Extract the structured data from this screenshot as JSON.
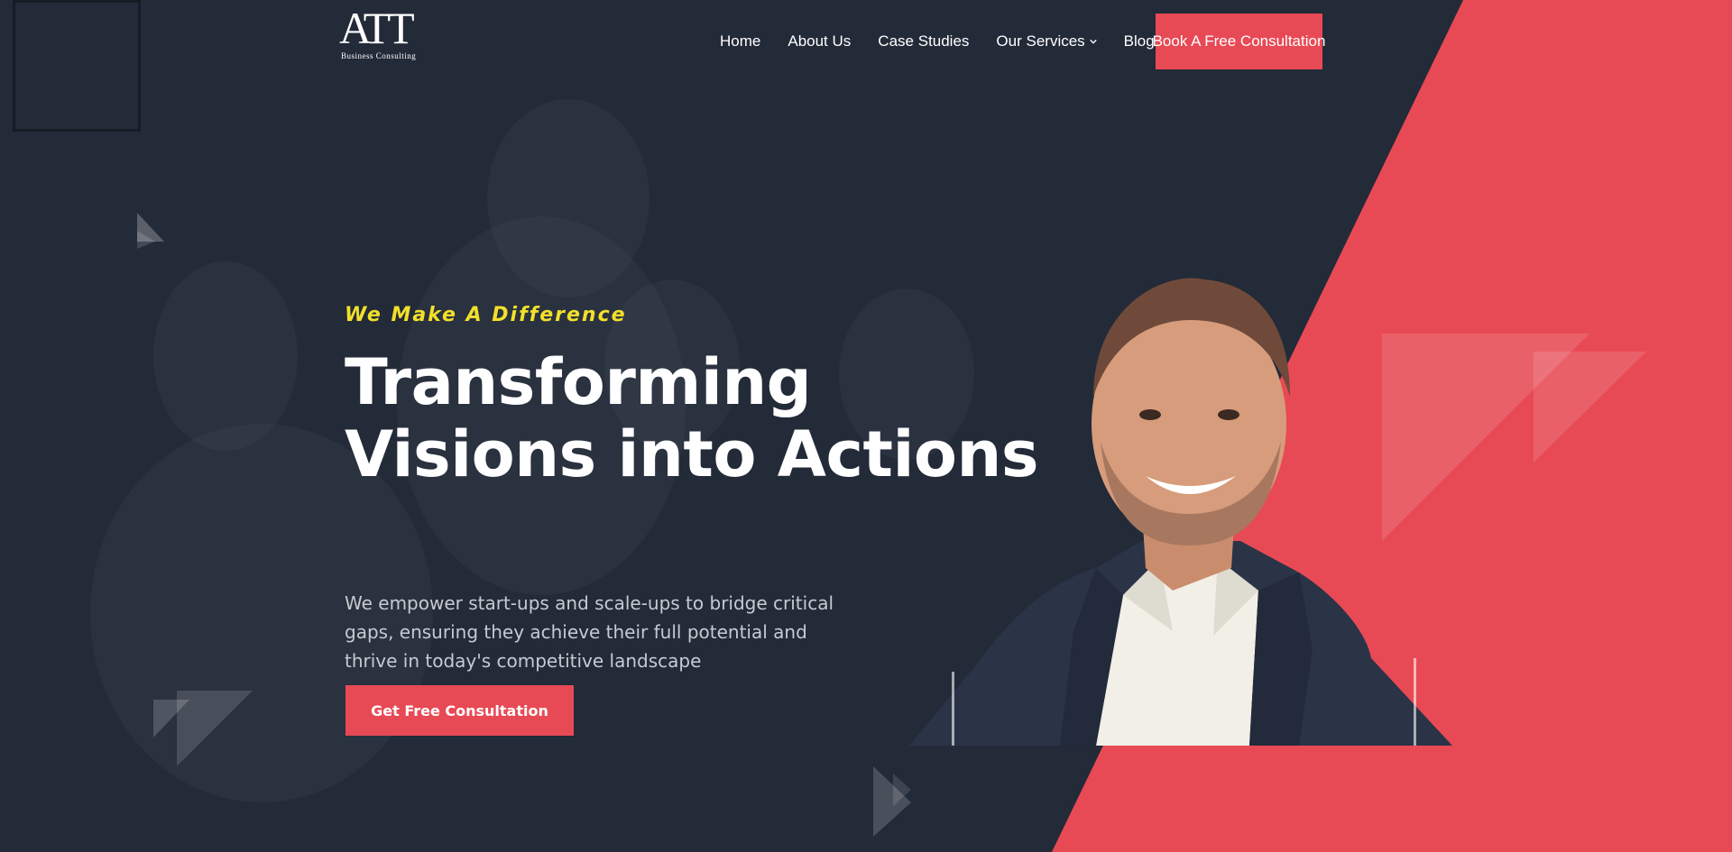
{
  "logo": {
    "mark": "ATT",
    "subtitle": "Business Consulting"
  },
  "nav": {
    "items": [
      {
        "label": "Home"
      },
      {
        "label": "About Us"
      },
      {
        "label": "Case Studies"
      },
      {
        "label": "Our Services",
        "has_dropdown": true
      },
      {
        "label": "Blog"
      }
    ],
    "cta_label": "Book A Free Consultation"
  },
  "hero": {
    "tagline": "We Make A Difference",
    "headline_line1": "Transforming",
    "headline_line2": "Visions into Actions",
    "body": "We empower start-ups and scale-ups to bridge critical gaps, ensuring they achieve their full potential and thrive in today's competitive landscape",
    "cta_label": "Get Free Consultation"
  },
  "colors": {
    "background": "#232a38",
    "accent_red": "#e84a55",
    "tagline_yellow": "#f2e02a",
    "text_white": "#ffffff",
    "body_text": "#c7cad1"
  },
  "icons": {
    "dropdown": "chevron-down-icon"
  }
}
